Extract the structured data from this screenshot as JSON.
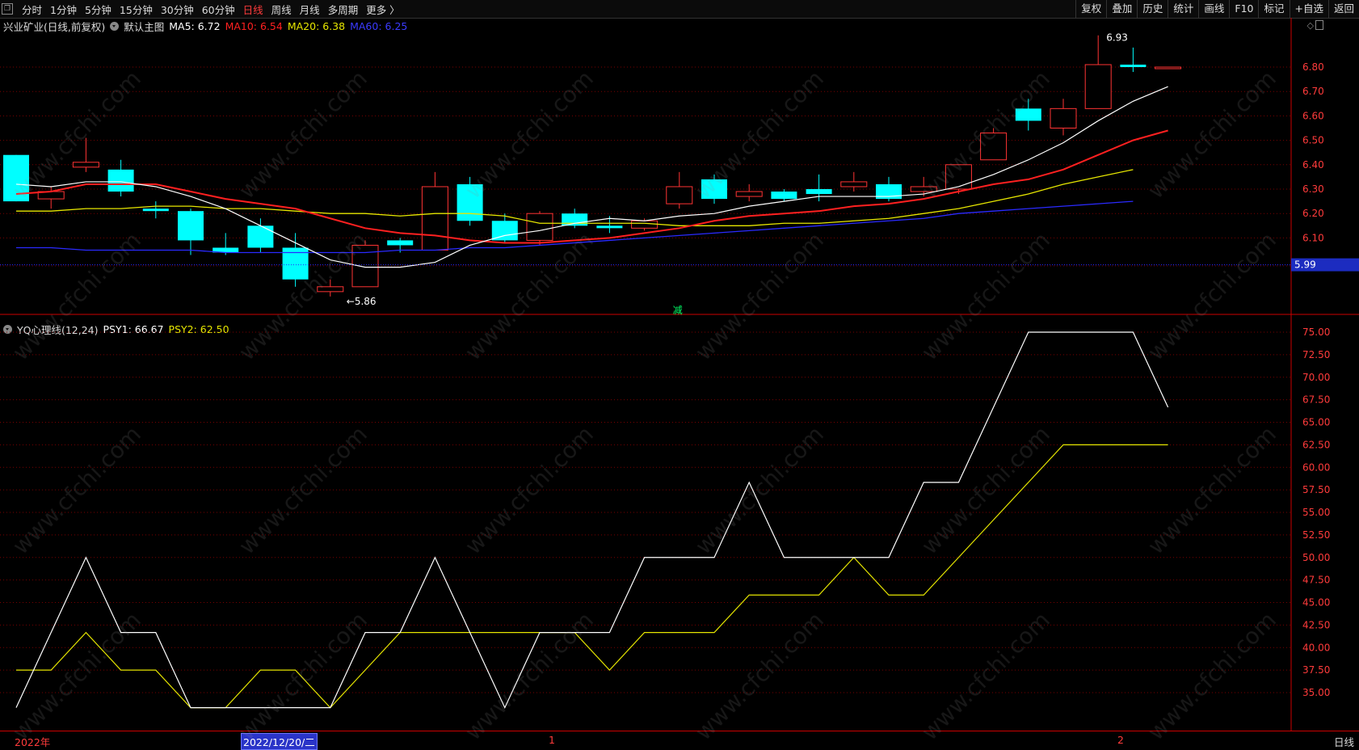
{
  "toolbar": {
    "tabs": [
      "分时",
      "1分钟",
      "5分钟",
      "15分钟",
      "30分钟",
      "60分钟",
      "日线",
      "周线",
      "月线",
      "多周期",
      "更多 〉"
    ],
    "active_tab": "日线",
    "right_buttons": [
      "复权",
      "叠加",
      "历史",
      "统计",
      "画线",
      "F10",
      "标记",
      "+自选",
      "返回"
    ]
  },
  "main_legend": {
    "stock": "兴业矿业(日线,前复权)",
    "template": "默认主图",
    "ma5": "MA5: 6.72",
    "ma10": "MA10: 6.54",
    "ma20": "MA20: 6.38",
    "ma60": "MA60: 6.25"
  },
  "sub_legend": {
    "indicator": "YQ心理线(12,24)",
    "psy1": "PSY1: 66.67",
    "psy2": "PSY2: 62.50"
  },
  "bottom": {
    "year_label": "2022年",
    "selected_date": "2022/12/20/二",
    "month1": "1",
    "month2": "2",
    "mode": "日线"
  },
  "annotations": {
    "high": "6.93",
    "low": "5.86",
    "reduce_mark": "减",
    "current_price": "5.99"
  },
  "watermark": "www.cfchi.com",
  "colors": {
    "up": "#ff3333",
    "down": "#00ffff",
    "ma5": "#ffffff",
    "ma10": "#ff2020",
    "ma20": "#e6e600",
    "ma60": "#2a2aff",
    "psy1": "#ffffff",
    "psy2": "#e6e600"
  },
  "chart_data": [
    {
      "type": "candlestick",
      "title": "兴业矿业(日线,前复权)",
      "y_ticks": [
        6.1,
        6.2,
        6.3,
        6.4,
        6.5,
        6.6,
        6.7,
        6.8
      ],
      "ylim": [
        5.8,
        7.0
      ],
      "candles": [
        {
          "o": 6.44,
          "c": 6.25,
          "h": 6.44,
          "l": 6.25
        },
        {
          "o": 6.26,
          "c": 6.29,
          "h": 6.31,
          "l": 6.22
        },
        {
          "o": 6.39,
          "c": 6.41,
          "h": 6.51,
          "l": 6.37
        },
        {
          "o": 6.38,
          "c": 6.29,
          "h": 6.42,
          "l": 6.27
        },
        {
          "o": 6.22,
          "c": 6.21,
          "h": 6.25,
          "l": 6.18
        },
        {
          "o": 6.21,
          "c": 6.09,
          "h": 6.22,
          "l": 6.03
        },
        {
          "o": 6.06,
          "c": 6.04,
          "h": 6.12,
          "l": 6.03
        },
        {
          "o": 6.15,
          "c": 6.06,
          "h": 6.18,
          "l": 6.04
        },
        {
          "o": 6.06,
          "c": 5.93,
          "h": 6.12,
          "l": 5.9
        },
        {
          "o": 5.88,
          "c": 5.9,
          "h": 5.93,
          "l": 5.86
        },
        {
          "o": 5.9,
          "c": 6.07,
          "h": 6.09,
          "l": 5.9
        },
        {
          "o": 6.09,
          "c": 6.07,
          "h": 6.1,
          "l": 6.04
        },
        {
          "o": 6.05,
          "c": 6.31,
          "h": 6.37,
          "l": 6.05
        },
        {
          "o": 6.32,
          "c": 6.17,
          "h": 6.35,
          "l": 6.15
        },
        {
          "o": 6.17,
          "c": 6.09,
          "h": 6.2,
          "l": 6.08
        },
        {
          "o": 6.09,
          "c": 6.2,
          "h": 6.21,
          "l": 6.07
        },
        {
          "o": 6.2,
          "c": 6.15,
          "h": 6.22,
          "l": 6.14
        },
        {
          "o": 6.15,
          "c": 6.14,
          "h": 6.19,
          "l": 6.12
        },
        {
          "o": 6.14,
          "c": 6.17,
          "h": 6.18,
          "l": 6.13
        },
        {
          "o": 6.24,
          "c": 6.31,
          "h": 6.37,
          "l": 6.22
        },
        {
          "o": 6.34,
          "c": 6.26,
          "h": 6.36,
          "l": 6.24
        },
        {
          "o": 6.27,
          "c": 6.29,
          "h": 6.32,
          "l": 6.25
        },
        {
          "o": 6.29,
          "c": 6.26,
          "h": 6.3,
          "l": 6.25
        },
        {
          "o": 6.3,
          "c": 6.28,
          "h": 6.36,
          "l": 6.25
        },
        {
          "o": 6.31,
          "c": 6.33,
          "h": 6.37,
          "l": 6.29
        },
        {
          "o": 6.32,
          "c": 6.26,
          "h": 6.35,
          "l": 6.25
        },
        {
          "o": 6.29,
          "c": 6.31,
          "h": 6.35,
          "l": 6.27
        },
        {
          "o": 6.3,
          "c": 6.4,
          "h": 6.4,
          "l": 6.28
        },
        {
          "o": 6.42,
          "c": 6.53,
          "h": 6.55,
          "l": 6.42
        },
        {
          "o": 6.63,
          "c": 6.58,
          "h": 6.67,
          "l": 6.54
        },
        {
          "o": 6.55,
          "c": 6.63,
          "h": 6.67,
          "l": 6.52
        },
        {
          "o": 6.63,
          "c": 6.81,
          "h": 6.93,
          "l": 6.63
        },
        {
          "o": 6.81,
          "c": 6.8,
          "h": 6.88,
          "l": 6.78
        },
        {
          "o": 6.8,
          "c": 6.8,
          "h": 6.8,
          "l": 6.8
        }
      ],
      "ma5": [
        6.32,
        6.31,
        6.33,
        6.33,
        6.31,
        6.27,
        6.22,
        6.15,
        6.08,
        6.01,
        5.98,
        5.98,
        6.0,
        6.07,
        6.11,
        6.13,
        6.16,
        6.18,
        6.17,
        6.19,
        6.2,
        6.23,
        6.25,
        6.27,
        6.27,
        6.27,
        6.28,
        6.31,
        6.36,
        6.42,
        6.49,
        6.58,
        6.66,
        6.72
      ],
      "ma10": [
        6.28,
        6.29,
        6.32,
        6.32,
        6.32,
        6.29,
        6.26,
        6.24,
        6.22,
        6.18,
        6.14,
        6.12,
        6.11,
        6.09,
        6.08,
        6.08,
        6.09,
        6.1,
        6.12,
        6.14,
        6.17,
        6.19,
        6.2,
        6.21,
        6.23,
        6.24,
        6.26,
        6.29,
        6.32,
        6.34,
        6.38,
        6.44,
        6.5,
        6.54
      ],
      "ma20": [
        6.21,
        6.21,
        6.22,
        6.22,
        6.23,
        6.23,
        6.22,
        6.22,
        6.21,
        6.2,
        6.2,
        6.19,
        6.2,
        6.2,
        6.19,
        6.16,
        6.16,
        6.16,
        6.16,
        6.15,
        6.15,
        6.15,
        6.16,
        6.16,
        6.17,
        6.18,
        6.2,
        6.22,
        6.25,
        6.28,
        6.32,
        6.35,
        6.38
      ],
      "ma60": [
        6.06,
        6.06,
        6.05,
        6.05,
        6.05,
        6.05,
        6.04,
        6.04,
        6.04,
        6.04,
        6.04,
        6.05,
        6.05,
        6.06,
        6.06,
        6.07,
        6.08,
        6.09,
        6.1,
        6.11,
        6.12,
        6.13,
        6.14,
        6.15,
        6.16,
        6.17,
        6.18,
        6.2,
        6.21,
        6.22,
        6.23,
        6.24,
        6.25
      ]
    },
    {
      "type": "line",
      "title": "YQ心理线(12,24)",
      "y_ticks": [
        35,
        37.5,
        40,
        42.5,
        45,
        47.5,
        50,
        52.5,
        55,
        57.5,
        60,
        62.5,
        65,
        67.5,
        70,
        72.5,
        75
      ],
      "ylim": [
        33,
        76
      ],
      "series": [
        {
          "name": "PSY1",
          "values": [
            33.33,
            41.67,
            50,
            41.67,
            41.67,
            33.33,
            33.33,
            33.33,
            33.33,
            33.33,
            41.67,
            41.67,
            50,
            41.67,
            33.33,
            41.67,
            41.67,
            41.67,
            50,
            50,
            50,
            58.33,
            50,
            50,
            50,
            50,
            58.33,
            58.33,
            66.67,
            75,
            75,
            75,
            75,
            66.67
          ]
        },
        {
          "name": "PSY2",
          "values": [
            37.5,
            37.5,
            41.67,
            37.5,
            37.5,
            33.33,
            33.33,
            37.5,
            37.5,
            33.33,
            37.5,
            41.67,
            41.67,
            41.67,
            41.67,
            41.67,
            41.67,
            37.5,
            41.67,
            41.67,
            41.67,
            45.83,
            45.83,
            45.83,
            50,
            45.83,
            45.83,
            50,
            54.17,
            58.33,
            62.5,
            62.5,
            62.5,
            62.5
          ]
        }
      ]
    }
  ]
}
